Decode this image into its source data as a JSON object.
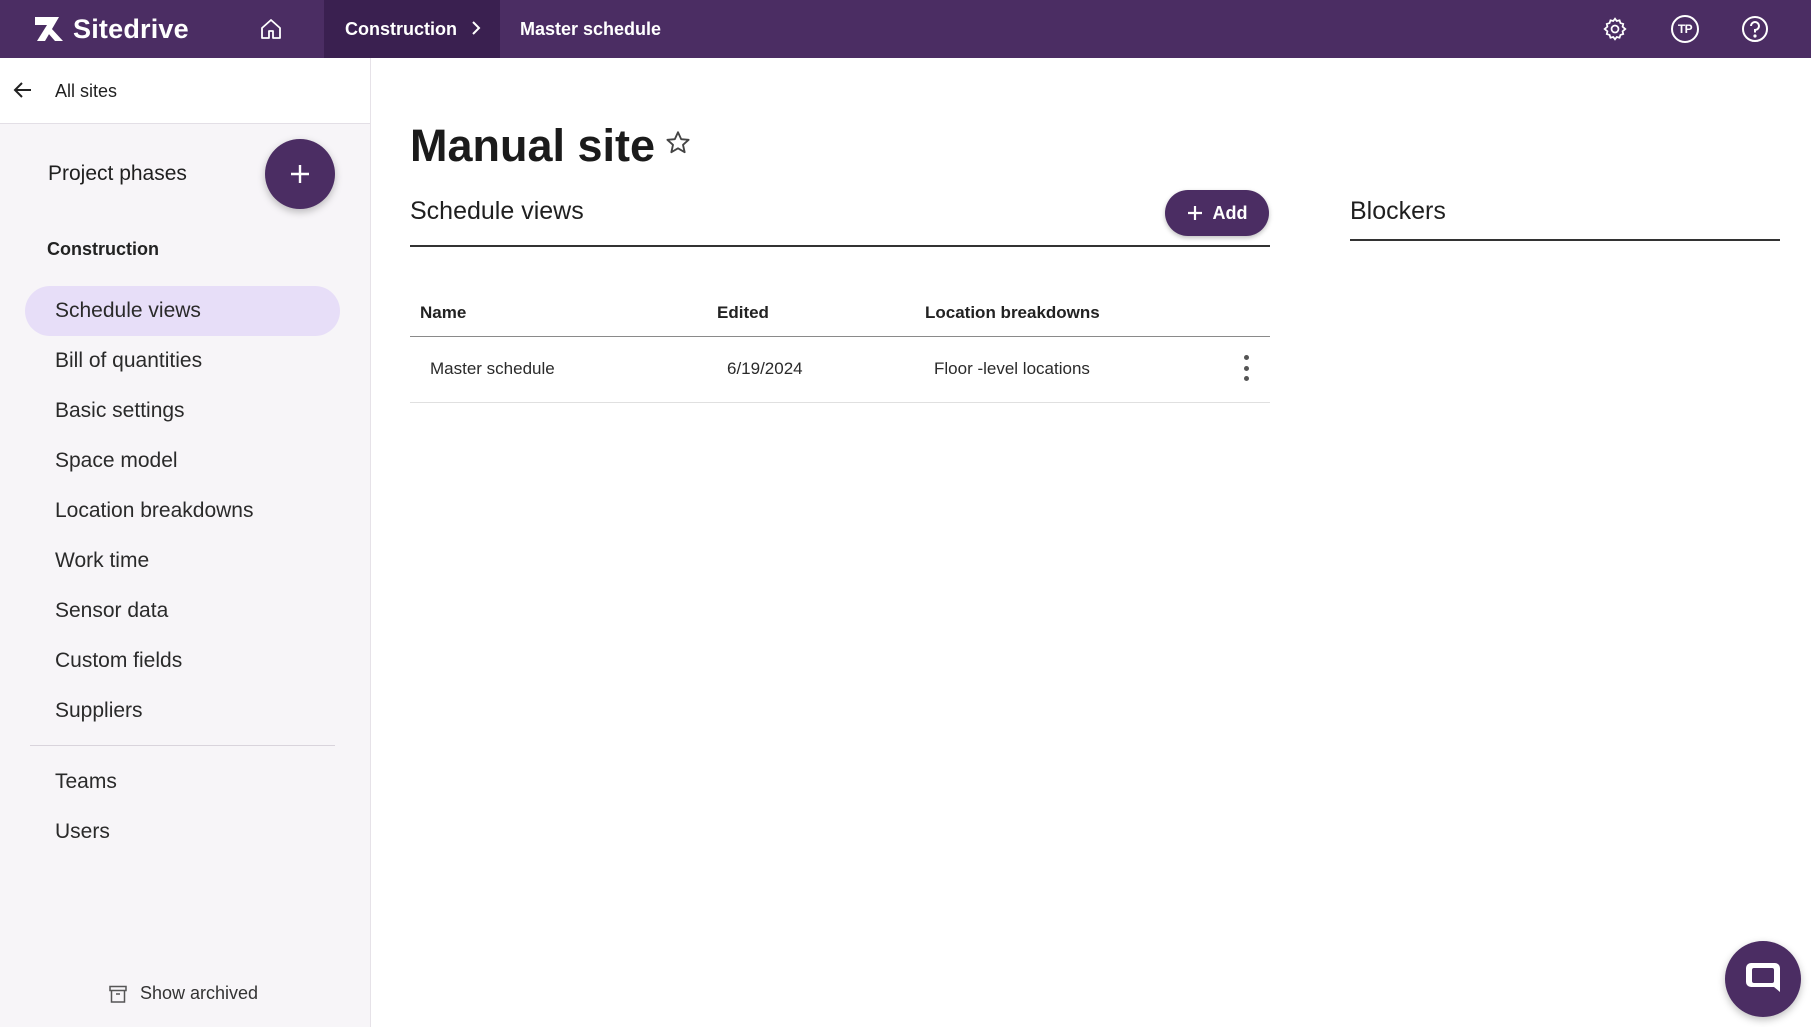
{
  "brand": {
    "name": "Sitedrive",
    "accent": "#4b2d63"
  },
  "header": {
    "home_icon": "home-icon",
    "breadcrumbs": [
      {
        "label": "Construction"
      },
      {
        "label": "Master schedule"
      }
    ],
    "settings_icon": "gear-icon",
    "avatar_initials": "TP",
    "help_icon": "help-icon"
  },
  "sidebar": {
    "back_label": "All sites",
    "section_title": "Project phases",
    "group_label": "Construction",
    "items": [
      {
        "label": "Schedule views",
        "active": true
      },
      {
        "label": "Bill of quantities"
      },
      {
        "label": "Basic settings"
      },
      {
        "label": "Space model"
      },
      {
        "label": "Location breakdowns"
      },
      {
        "label": "Work time"
      },
      {
        "label": "Sensor data"
      },
      {
        "label": "Custom fields"
      },
      {
        "label": "Suppliers"
      }
    ],
    "secondary_items": [
      {
        "label": "Teams"
      },
      {
        "label": "Users"
      }
    ],
    "show_archived_label": "Show archived"
  },
  "main": {
    "title": "Manual site",
    "schedule_views": {
      "title": "Schedule views",
      "add_label": "Add",
      "columns": [
        "Name",
        "Edited",
        "Location breakdowns"
      ],
      "rows": [
        {
          "name": "Master schedule",
          "edited": "6/19/2024",
          "location": "Floor -level locations"
        }
      ]
    },
    "blockers": {
      "title": "Blockers"
    }
  }
}
